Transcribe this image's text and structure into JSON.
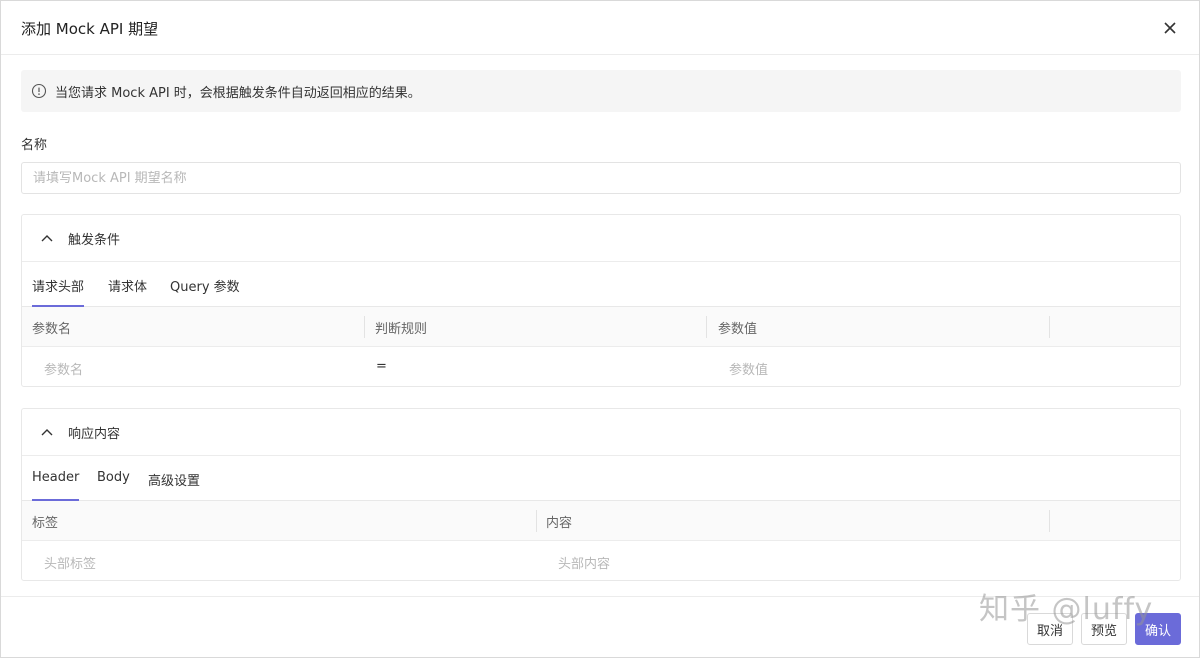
{
  "modal": {
    "title": "添加 Mock API 期望",
    "close_icon": "close-icon"
  },
  "info": {
    "icon": "info-icon",
    "text": "当您请求 Mock API 时，会根据触发条件自动返回相应的结果。"
  },
  "name_field": {
    "label": "名称",
    "value": "",
    "placeholder": "请填写Mock API 期望名称"
  },
  "trigger": {
    "title": "触发条件",
    "tabs": [
      {
        "label": "请求头部",
        "active": true
      },
      {
        "label": "请求体",
        "active": false
      },
      {
        "label": "Query 参数",
        "active": false
      }
    ],
    "columns": [
      "参数名",
      "判断规则",
      "参数值"
    ],
    "row": {
      "name": "参数名",
      "rule": "=",
      "value": "参数值"
    }
  },
  "response": {
    "title": "响应内容",
    "tabs": [
      {
        "label": "Header",
        "active": true
      },
      {
        "label": "Body",
        "active": false
      },
      {
        "label": "高级设置",
        "active": false
      }
    ],
    "columns": [
      "标签",
      "内容"
    ],
    "row": {
      "tag": "头部标签",
      "content": "头部内容"
    }
  },
  "footer": {
    "cancel": "取消",
    "preview": "预览",
    "confirm": "确认"
  },
  "watermark": "知乎 @luffy",
  "colors": {
    "primary": "#6b6bd9",
    "info_bg": "#f5f5f5",
    "border": "#e8e8e8"
  }
}
